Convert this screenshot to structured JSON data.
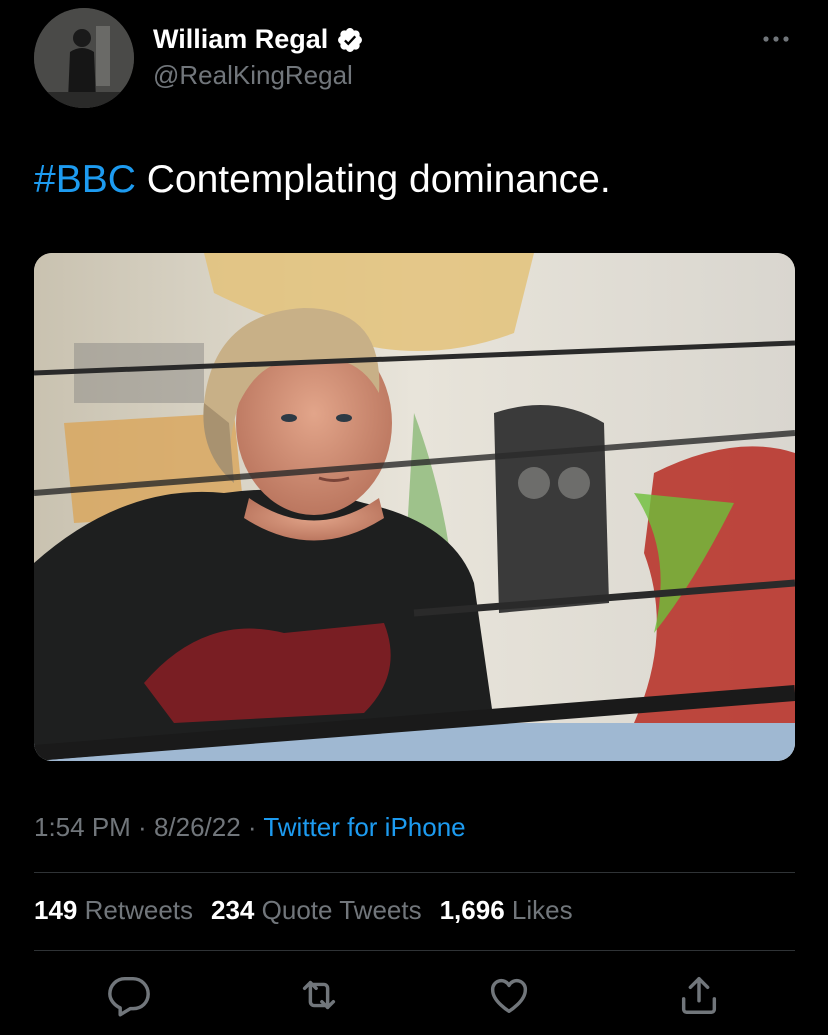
{
  "author": {
    "display_name": "William Regal",
    "handle": "@RealKingRegal",
    "verified": true,
    "avatar_icon": "profile-photo"
  },
  "tweet": {
    "hashtag": "#BBC",
    "text": " Contemplating dominance.",
    "media_description": "photo"
  },
  "meta": {
    "time": "1:54 PM",
    "separator": " · ",
    "date": "8/26/22",
    "source": "Twitter for iPhone"
  },
  "stats": {
    "retweets_count": "149",
    "retweets_label": "Retweets",
    "quotes_count": "234",
    "quotes_label": "Quote Tweets",
    "likes_count": "1,696",
    "likes_label": "Likes"
  },
  "actions": {
    "reply_icon": "reply-icon",
    "retweet_icon": "retweet-icon",
    "like_icon": "like-icon",
    "share_icon": "share-icon"
  },
  "colors": {
    "background": "#000000",
    "accent": "#1d9bf0",
    "secondary_text": "#71767b",
    "divider": "#2f3336"
  }
}
